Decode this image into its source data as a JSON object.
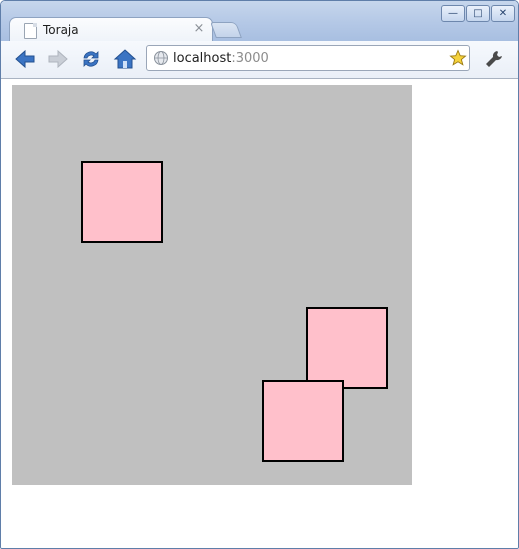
{
  "browser": {
    "tab_title": "Toraja",
    "tab_close": "×",
    "url_host": "localhost",
    "url_port": ":3000",
    "window_controls": {
      "minimize": "—",
      "maximize": "□",
      "close": "✕"
    },
    "toolbar_icons": [
      "back-arrow-icon",
      "forward-arrow-icon",
      "reload-icon",
      "home-icon",
      "globe-icon",
      "star-icon",
      "wrench-icon"
    ]
  },
  "page": {
    "stage_color": "#c0c0c0",
    "square_fill": "#ffc0cb",
    "square_count": 3
  }
}
